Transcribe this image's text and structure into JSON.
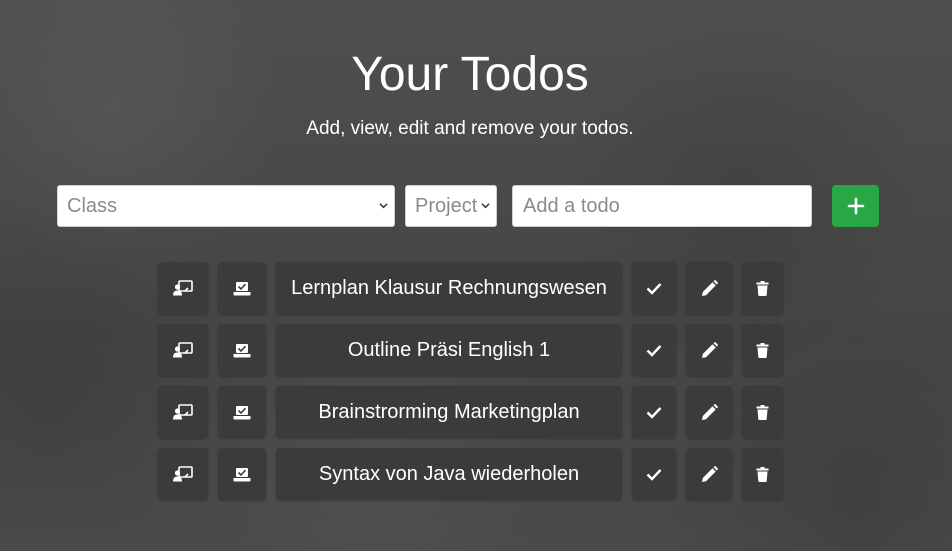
{
  "header": {
    "title": "Your Todos",
    "subtitle": "Add, view, edit and remove your todos."
  },
  "form": {
    "class_select": {
      "selected": "Class"
    },
    "project_select": {
      "selected": "Project"
    },
    "todo_input": {
      "placeholder": "Add a todo",
      "value": ""
    },
    "add_button_icon": "plus-icon"
  },
  "todos": [
    {
      "text": "Lernplan Klausur Rechnungswesen"
    },
    {
      "text": "Outline Präsi English 1"
    },
    {
      "text": "Brainstrorming Marketingplan"
    },
    {
      "text": "Syntax von Java wiederholen"
    }
  ],
  "icons": {
    "class": "teacher-icon",
    "project": "laptop-check-icon",
    "done": "check-icon",
    "edit": "pencil-icon",
    "delete": "trash-icon"
  },
  "colors": {
    "accent_green": "#28a745",
    "item_background": "#3b3b3b",
    "text": "#ffffff"
  }
}
